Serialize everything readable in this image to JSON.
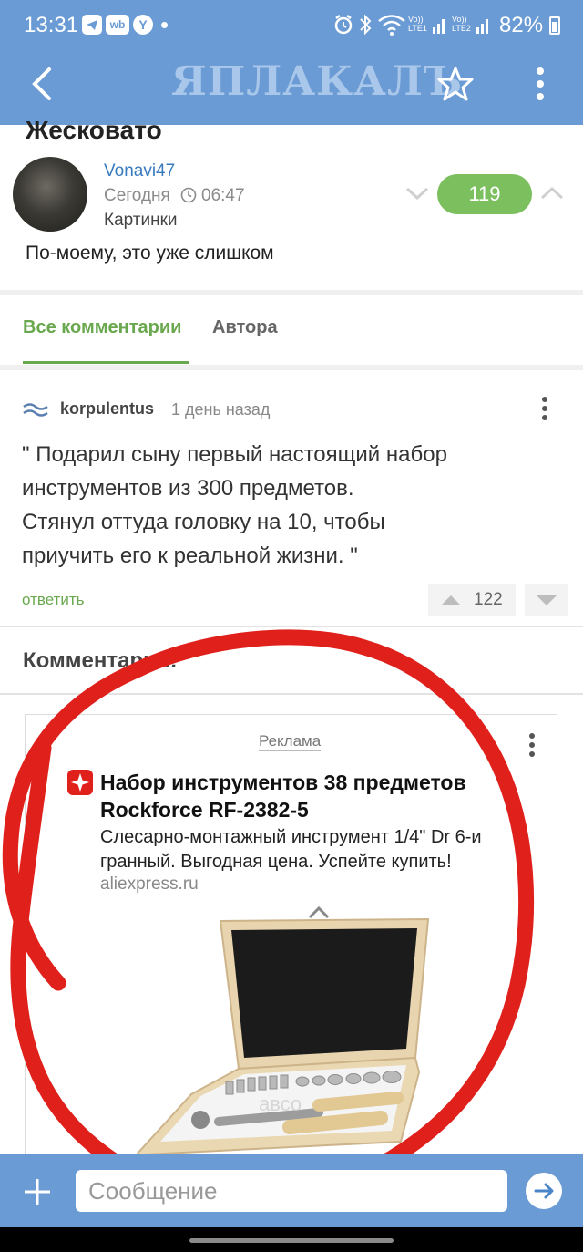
{
  "status_bar": {
    "time": "13:31",
    "left_icons": [
      "telegram-icon",
      "wildberries-icon",
      "yandex-icon",
      "dot-icon"
    ],
    "battery": "82%",
    "network_labels": [
      "Vo)) LTE1",
      "Vo)) LTE2"
    ]
  },
  "app_bar": {
    "title": "ЯПЛАКАЛЪ"
  },
  "post": {
    "title": "Жесковато",
    "author": "Vonavi47",
    "date": "Сегодня",
    "time": "06:47",
    "category": "Картинки",
    "rating": "119",
    "text": "По-моему, это уже слишком"
  },
  "tabs": [
    {
      "label": "Все комментарии",
      "active": true
    },
    {
      "label": "Автора",
      "active": false
    }
  ],
  "comment": {
    "author": "korpulentus",
    "time": "1 день назад",
    "lines": [
      "\" Подарил сыну первый настоящий набор",
      "инструментов из 300 предметов.",
      "Стянул оттуда головку на 10, чтобы",
      "приучить его к реальной жизни. \""
    ],
    "reply_label": "ответить",
    "rating": "122"
  },
  "comments_section": {
    "title": "Комментарии:"
  },
  "ad": {
    "label": "Реклама",
    "title_line1": "Набор инструментов 38 предметов",
    "title_line2": "Rockforce RF-2382-5",
    "desc_line1": "Слесарно-монтажный инструмент 1/4\" Dr 6-и",
    "desc_line2": "гранный. Выгодная цена. Успейте купить!",
    "domain": "aliexpress.ru",
    "watermark": "авсо"
  },
  "compose": {
    "placeholder": "Сообщение"
  },
  "colors": {
    "bar_blue": "#6b9bd4",
    "accent_green": "#6aa84f",
    "vote_green": "#7bbf5e",
    "annotation_red": "#e0201b",
    "link_blue": "#3a7bbf"
  }
}
